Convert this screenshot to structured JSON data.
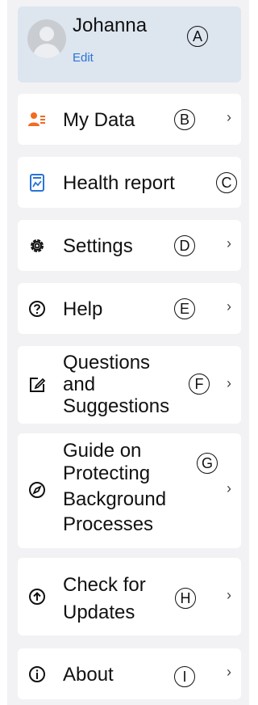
{
  "profile": {
    "name": "Johanna",
    "edit_label": "Edit",
    "marker": "A"
  },
  "menu": [
    {
      "label": "My Data",
      "marker": "B",
      "icon": "user-list-icon"
    },
    {
      "label": "Health report",
      "marker": "C",
      "icon": "report-chart-icon"
    },
    {
      "label": "Settings",
      "marker": "D",
      "icon": "gear-icon"
    },
    {
      "label": "Help",
      "marker": "E",
      "icon": "help-icon"
    },
    {
      "label_lines": [
        "Questions",
        "and",
        "Suggestions"
      ],
      "marker": "F",
      "icon": "edit-note-icon"
    },
    {
      "label_lines": [
        "Guide on",
        "Protecting",
        "Background",
        "Processes"
      ],
      "marker": "G",
      "icon": "compass-icon"
    },
    {
      "label_lines": [
        "Check for",
        "Updates"
      ],
      "marker": "H",
      "icon": "upload-icon"
    },
    {
      "label": "About",
      "marker": "I",
      "icon": "info-icon"
    }
  ],
  "chevron": "›",
  "colors": {
    "accent": "#2a74d6",
    "mydata_icon": "#f26b21",
    "panel": "#f2f2f4",
    "profile_bg": "#dde5ef"
  }
}
